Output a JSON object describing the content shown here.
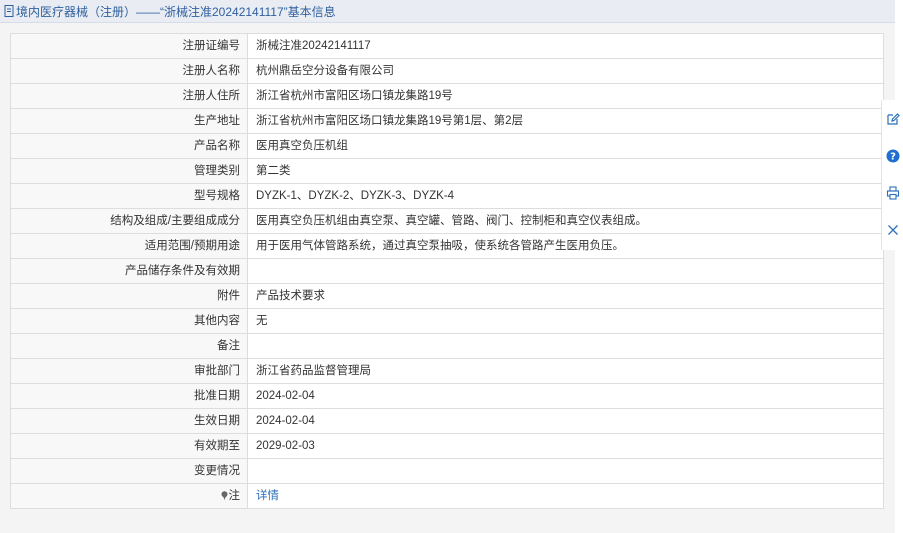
{
  "header": {
    "title": "境内医疗器械（注册）——“浙械注准20242141117”基本信息",
    "icon": "document-icon",
    "text_color": "#2f5f9d"
  },
  "rows": [
    {
      "label": "注册证编号",
      "value": "浙械注准20242141117"
    },
    {
      "label": "注册人名称",
      "value": "杭州鼎岳空分设备有限公司"
    },
    {
      "label": "注册人住所",
      "value": "浙江省杭州市富阳区场口镇龙集路19号"
    },
    {
      "label": "生产地址",
      "value": "浙江省杭州市富阳区场口镇龙集路19号第1层、第2层"
    },
    {
      "label": "产品名称",
      "value": "医用真空负压机组"
    },
    {
      "label": "管理类别",
      "value": "第二类"
    },
    {
      "label": "型号规格",
      "value": "DYZK-1、DYZK-2、DYZK-3、DYZK-4"
    },
    {
      "label": "结构及组成/主要组成成分",
      "value": "医用真空负压机组由真空泵、真空罐、管路、阀门、控制柜和真空仪表组成。"
    },
    {
      "label": "适用范围/预期用途",
      "value": "用于医用气体管路系统，通过真空泵抽吸，使系统各管路产生医用负压。"
    },
    {
      "label": "产品储存条件及有效期",
      "value": ""
    },
    {
      "label": "附件",
      "value": "产品技术要求"
    },
    {
      "label": "其他内容",
      "value": "无"
    },
    {
      "label": "备注",
      "value": ""
    },
    {
      "label": "审批部门",
      "value": "浙江省药品监督管理局"
    },
    {
      "label": "批准日期",
      "value": "2024-02-04"
    },
    {
      "label": "生效日期",
      "value": "2024-02-04"
    },
    {
      "label": "有效期至",
      "value": "2029-02-03"
    },
    {
      "label": "变更情况",
      "value": ""
    }
  ],
  "note_row": {
    "label": "注",
    "link_text": "详情",
    "icon": "pin-icon"
  },
  "toolbar": [
    "edit-icon",
    "help-icon",
    "print-icon",
    "close-icon"
  ],
  "colors": {
    "link": "#2a6ebb",
    "help": "#1e6fd0"
  }
}
